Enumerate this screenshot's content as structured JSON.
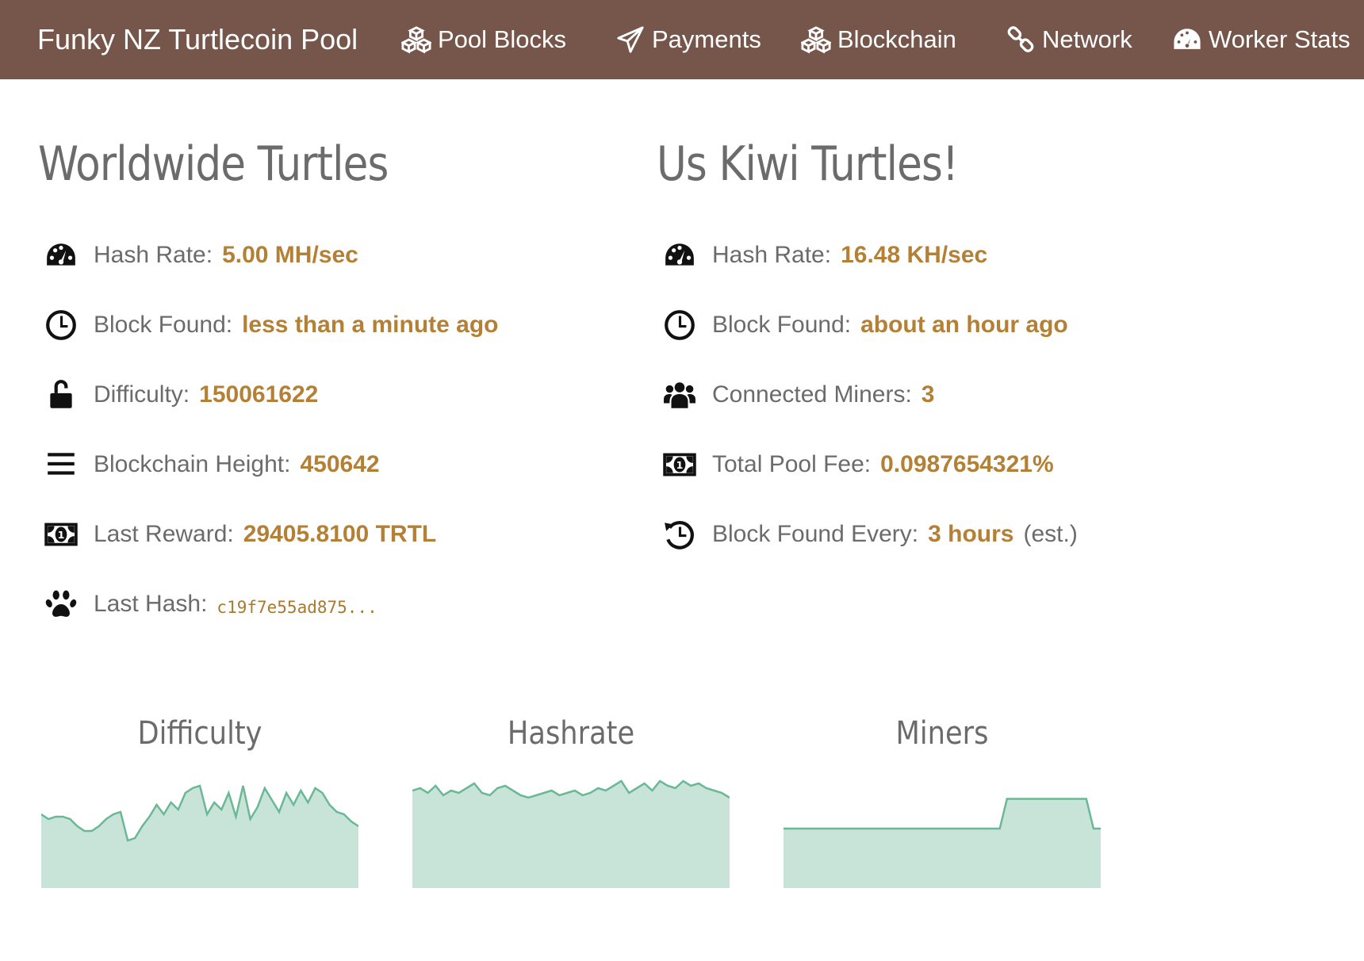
{
  "navbar": {
    "brand": "Funky NZ Turtlecoin Pool",
    "items": [
      {
        "label": "Pool Blocks",
        "icon": "cubes-icon"
      },
      {
        "label": "Payments",
        "icon": "paper-plane-icon"
      },
      {
        "label": "Blockchain",
        "icon": "cubes-icon"
      },
      {
        "label": "Network",
        "icon": "link-icon"
      },
      {
        "label": "Worker Stats",
        "icon": "dashboard-icon"
      }
    ]
  },
  "worldwide": {
    "title": "Worldwide Turtles",
    "stats": [
      {
        "icon": "dashboard-icon",
        "label": "Hash Rate:",
        "value": "5.00 MH/sec"
      },
      {
        "icon": "clock-icon",
        "label": "Block Found:",
        "value": "less than a minute ago"
      },
      {
        "icon": "unlock-icon",
        "label": "Difficulty:",
        "value": "150061622"
      },
      {
        "icon": "bars-icon",
        "label": "Blockchain Height:",
        "value": "450642"
      },
      {
        "icon": "money-icon",
        "label": "Last Reward:",
        "value": "29405.8100 TRTL"
      },
      {
        "icon": "paw-icon",
        "label": "Last Hash:",
        "value": "c19f7e55ad875..."
      }
    ]
  },
  "kiwi": {
    "title": "Us Kiwi Turtles!",
    "stats": [
      {
        "icon": "dashboard-icon",
        "label": "Hash Rate:",
        "value": "16.48 KH/sec"
      },
      {
        "icon": "clock-icon",
        "label": "Block Found:",
        "value": "about an hour ago"
      },
      {
        "icon": "users-icon",
        "label": "Connected Miners:",
        "value": "3"
      },
      {
        "icon": "money-icon",
        "label": "Total Pool Fee:",
        "value": "0.0987654321%"
      },
      {
        "icon": "history-icon",
        "label": "Block Found Every:",
        "value": "3 hours",
        "suffix": "(est.)"
      }
    ]
  },
  "colors": {
    "navbar": "#76554a",
    "value": "#b38035",
    "chart_fill": "#c8e4d8",
    "chart_line": "#6bb896"
  },
  "chart_data": [
    {
      "type": "area",
      "title": "Difficulty",
      "values": [
        62,
        58,
        60,
        60,
        58,
        52,
        48,
        48,
        52,
        58,
        62,
        64,
        40,
        42,
        52,
        60,
        70,
        62,
        72,
        66,
        80,
        84,
        86,
        62,
        72,
        66,
        80,
        60,
        86,
        58,
        68,
        84,
        74,
        64,
        80,
        70,
        82,
        72,
        84,
        80,
        70,
        64,
        62,
        56,
        52
      ],
      "ylim": [
        0,
        100
      ]
    },
    {
      "type": "area",
      "title": "Hashrate",
      "values": [
        82,
        84,
        80,
        86,
        78,
        82,
        80,
        84,
        88,
        80,
        78,
        84,
        86,
        82,
        78,
        76,
        78,
        80,
        82,
        78,
        80,
        82,
        78,
        80,
        84,
        82,
        86,
        90,
        80,
        84,
        88,
        82,
        90,
        86,
        84,
        90,
        86,
        88,
        84,
        82,
        80,
        76
      ],
      "ylim": [
        0,
        100
      ]
    },
    {
      "type": "area",
      "title": "Miners",
      "values": [
        2,
        2,
        2,
        2,
        2,
        2,
        2,
        2,
        2,
        2,
        2,
        2,
        2,
        2,
        2,
        2,
        2,
        2,
        2,
        2,
        2,
        2,
        2,
        2,
        2,
        2,
        2,
        2,
        2,
        2,
        2,
        3,
        3,
        3,
        3,
        3,
        3,
        3,
        3,
        3,
        3,
        3,
        3,
        2,
        2
      ],
      "ylim": [
        0,
        4
      ]
    }
  ]
}
